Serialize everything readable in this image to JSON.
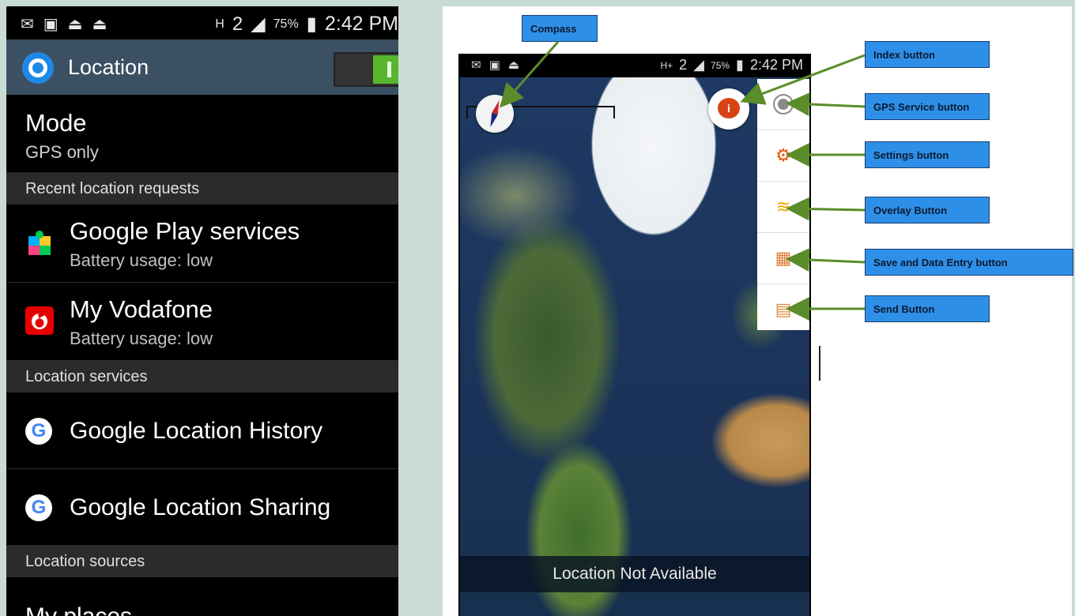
{
  "left_phone": {
    "status": {
      "icons": [
        "envelope-icon",
        "image-icon",
        "live-icon",
        "live-icon"
      ],
      "signal_label": "H",
      "sim_label": "2",
      "battery": "75%",
      "time": "2:42 PM"
    },
    "header": {
      "title": "Location",
      "toggle_state": "on",
      "accent": "#58b52e"
    },
    "mode": {
      "title": "Mode",
      "value": "GPS only"
    },
    "section_recent": "Recent location requests",
    "apps": [
      {
        "name": "Google Play services",
        "sub": "Battery usage: low"
      },
      {
        "name": "My Vodafone",
        "sub": "Battery usage: low"
      }
    ],
    "section_services": "Location services",
    "services": [
      {
        "name": "Google Location History"
      },
      {
        "name": "Google Location Sharing"
      }
    ],
    "section_sources": "Location sources",
    "myplaces": "My places"
  },
  "right_phone": {
    "status": {
      "signal_label": "H+",
      "sim_label": "2",
      "battery": "75%",
      "time": "2:42 PM"
    },
    "banner": "Location Not Available"
  },
  "callouts": {
    "compass": "Compass",
    "index": "Index button",
    "gps": "GPS Service button",
    "settings": "Settings button",
    "overlay": "Overlay Button",
    "save": "Save and Data Entry button",
    "send": "Send Button"
  },
  "colors": {
    "callout_fill": "#2e8fe8",
    "arrow": "#5b8c2a",
    "header_bg": "#3c5064"
  }
}
